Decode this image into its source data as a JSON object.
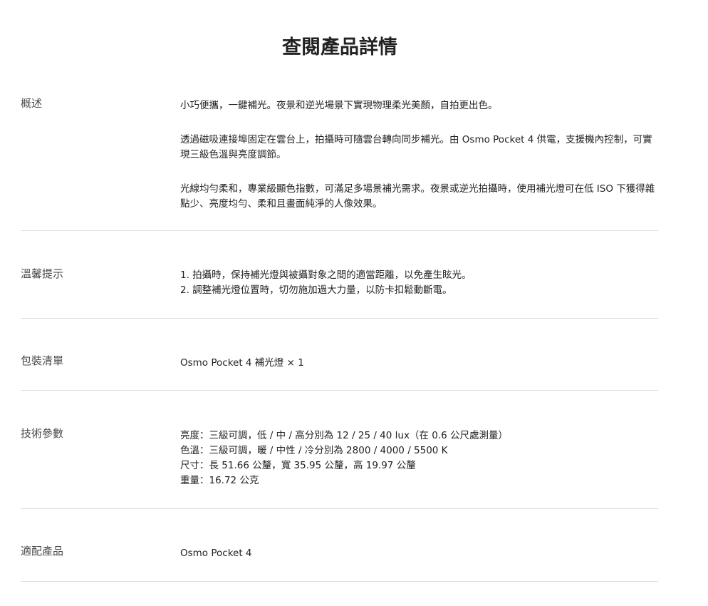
{
  "page": {
    "title": "查閱產品詳情"
  },
  "overview": {
    "label": "概述",
    "paragraphs": [
      "小巧便攜，一鍵補光。夜景和逆光場景下實現物理柔光美顏，自拍更出色。",
      "透過磁吸連接埠固定在雲台上，拍攝時可隨雲台轉向同步補光。由 Osmo Pocket 4 供電，支援機內控制，可實現三級色溫與亮度調節。",
      "光線均勻柔和，專業級顯色指數，可滿足多場景補光需求。夜景或逆光拍攝時，使用補光燈可在低 ISO 下獲得雜點少、亮度均勻、柔和且畫面純淨的人像效果。"
    ]
  },
  "tips": {
    "label": "溫馨提示",
    "lines": [
      "1. 拍攝時，保持補光燈與被攝對象之間的適當距離，以免產生眩光。",
      "2. 調整補光燈位置時，切勿施加過大力量，以防卡扣鬆動斷電。"
    ]
  },
  "package": {
    "label": "包裝清單",
    "text": "Osmo Pocket 4 補光燈 × 1"
  },
  "specs": {
    "label": "技術參數",
    "lines": [
      "亮度：三級可調，低 / 中 / 高分別為 12 / 25 / 40 lux（在 0.6 公尺處測量）",
      "色溫：三級可調，暖 / 中性 / 冷分別為 2800 / 4000 / 5500 K",
      "尺寸：長 51.66 公釐，寬 35.95 公釐，高 19.97 公釐",
      "重量：16.72 公克"
    ]
  },
  "compatible": {
    "label": "適配產品",
    "text": "Osmo Pocket 4"
  }
}
